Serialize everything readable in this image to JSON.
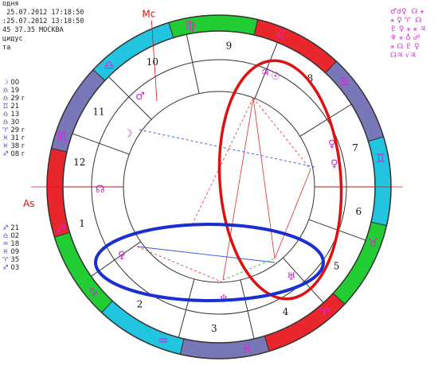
{
  "header": {
    "line1": "одня",
    "line2": " 25.07.2012 17:18:50",
    "line3": ":25.07.2012 13:18:50",
    "line4": "45 37.35 МОСКВА",
    "line5": "цидус",
    "line6": "та"
  },
  "planets_top": [
    {
      "glyph": "☽",
      "value": "00",
      "flag": ""
    },
    {
      "glyph": "♎",
      "value": "19",
      "flag": ""
    },
    {
      "glyph": "♎",
      "value": "29",
      "flag": "r"
    },
    {
      "glyph": "♊",
      "value": "21",
      "flag": ""
    },
    {
      "glyph": "♎",
      "value": "13",
      "flag": ""
    },
    {
      "glyph": "♎",
      "value": "30",
      "flag": ""
    },
    {
      "glyph": "♈",
      "value": "29",
      "flag": "r"
    },
    {
      "glyph": "♓",
      "value": "31",
      "flag": "r"
    },
    {
      "glyph": "♓",
      "value": "38",
      "flag": "r"
    },
    {
      "glyph": "♐",
      "value": "08",
      "flag": "r"
    }
  ],
  "planets_bottom": [
    {
      "glyph": "♐",
      "value": "21",
      "flag": ""
    },
    {
      "glyph": "♎",
      "value": "02",
      "flag": ""
    },
    {
      "glyph": "♒",
      "value": "18",
      "flag": ""
    },
    {
      "glyph": "♓",
      "value": "09",
      "flag": ""
    },
    {
      "glyph": "♈",
      "value": "35",
      "flag": ""
    },
    {
      "glyph": "♐",
      "value": "03",
      "flag": ""
    }
  ],
  "legend_lines": [
    "♂☌♀  ☊ ⚹",
    "⚹ ♀ ♈  ☊",
    "♇ ♀ ⚹ ⚹ ♃",
    "♆ ⚹ ♁ ☍",
    "⚹ ☊ ♇ ♀",
    "☊♃ √♃"
  ],
  "chart": {
    "mc_label": "Mc",
    "as_label": "As",
    "houses": [
      "1",
      "2",
      "3",
      "4",
      "5",
      "6",
      "7",
      "8",
      "9",
      "10",
      "11",
      "12"
    ],
    "signs": [
      "♍",
      "♌",
      "♋",
      "♊",
      "♉",
      "♈",
      "♓",
      "♒",
      "♑",
      "♐",
      "♏",
      "♎"
    ],
    "planet_glyphs": [
      {
        "name": "moon",
        "glyph": "☽"
      },
      {
        "name": "mars",
        "glyph": "♂"
      },
      {
        "name": "sun",
        "glyph": "☉"
      },
      {
        "name": "mercury",
        "glyph": "♀"
      },
      {
        "name": "venus",
        "glyph": "♀"
      },
      {
        "name": "jupiter",
        "glyph": "♃"
      },
      {
        "name": "uranus",
        "glyph": "♅"
      },
      {
        "name": "neptune",
        "glyph": "♆"
      },
      {
        "name": "pluto",
        "glyph": "♀"
      },
      {
        "name": "node",
        "glyph": "☊"
      }
    ],
    "colors": {
      "red": "#e8262b",
      "green": "#22cc33",
      "cyan": "#22c5e0",
      "slate": "#7878b8",
      "red_annotation": "#dd1111",
      "blue_annotation": "#1a2fd0"
    }
  }
}
